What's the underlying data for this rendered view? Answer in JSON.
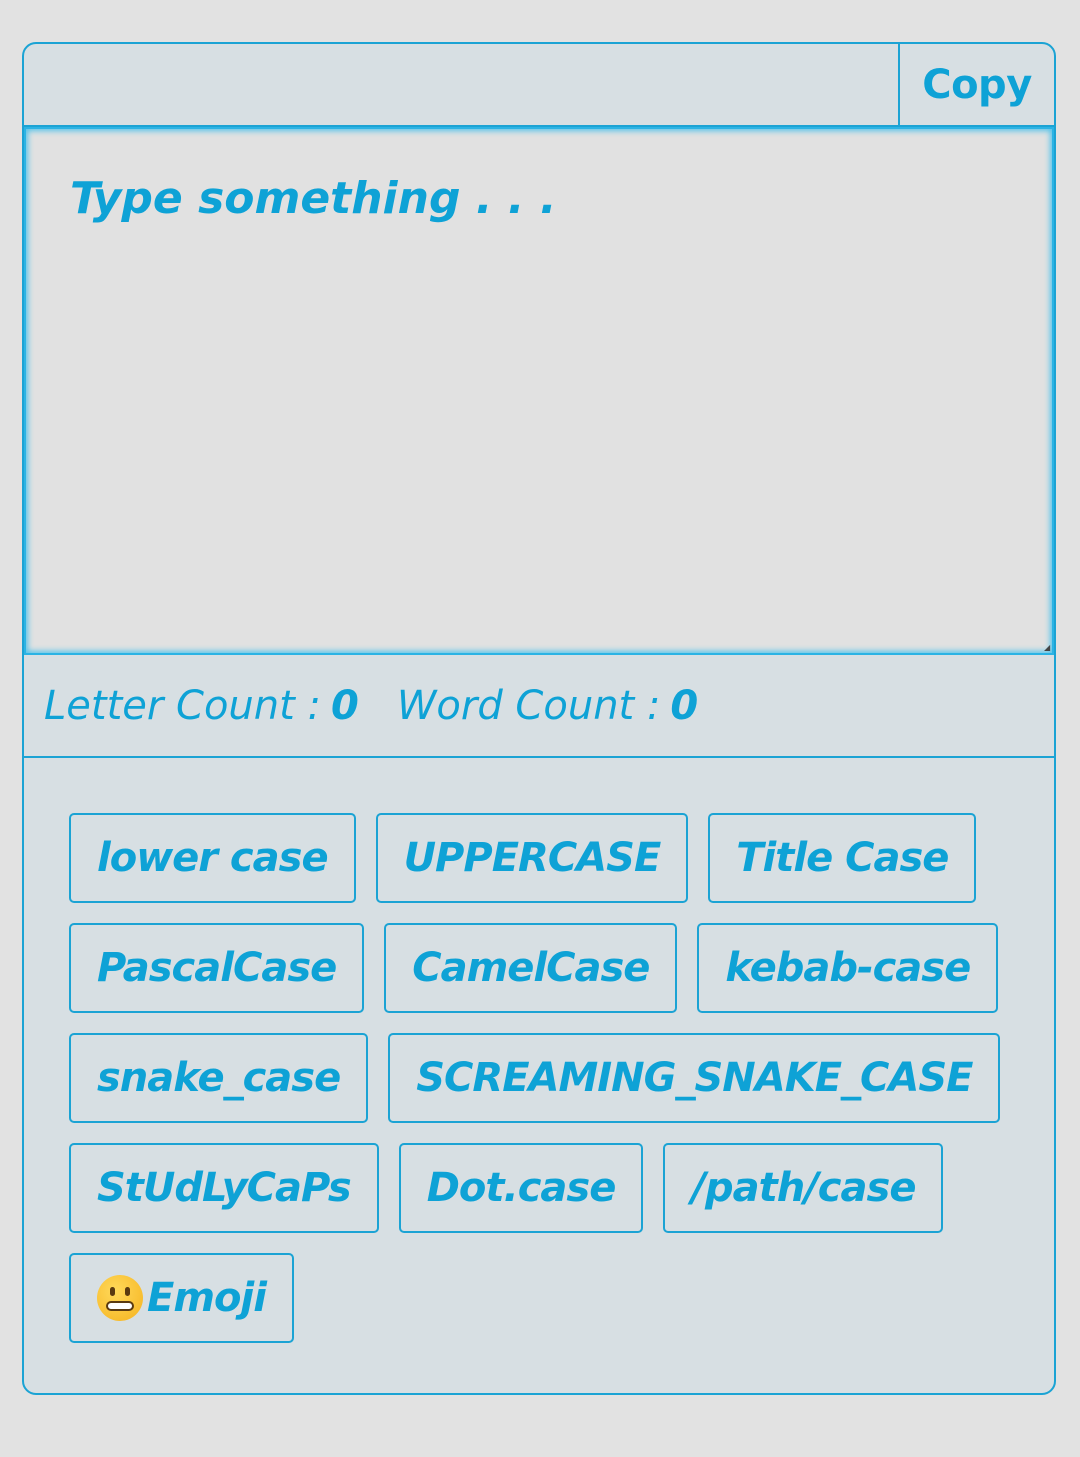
{
  "toolbar": {
    "copy_label": "Copy"
  },
  "editor": {
    "placeholder": "Type something . . ."
  },
  "counts": {
    "letter_label": "Letter Count :",
    "letter_value": "0",
    "word_label": "Word Count :",
    "word_value": "0"
  },
  "case_buttons": [
    "lower case",
    "UPPERCASE",
    "Title Case",
    "PascalCase",
    "CamelCase",
    "kebab-case",
    "snake_case",
    "SCREAMING_SNAKE_CASE",
    "StUdLyCaPs",
    "Dot.case",
    "/path/case",
    "Emoji"
  ],
  "colors": {
    "accent": "#0ea2d6",
    "border": "#1ba3d4",
    "card_bg": "#d7dfe3",
    "page_bg": "#e2e2e2"
  },
  "icons": {
    "emoji_button": "grimacing-face-icon"
  }
}
